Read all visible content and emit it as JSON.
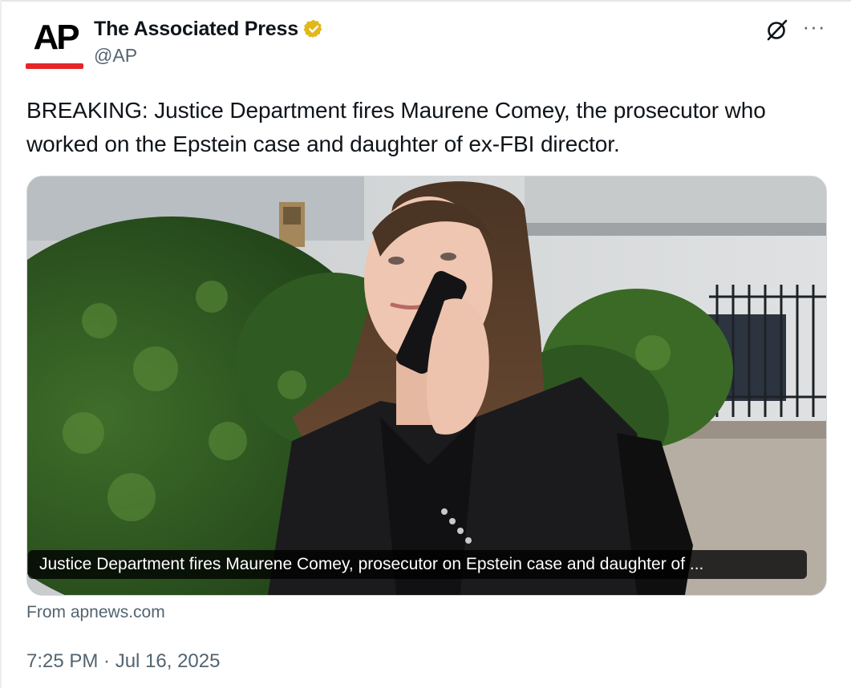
{
  "tweet": {
    "author": {
      "display_name": "The Associated Press",
      "handle": "@AP",
      "logo_text": "AP",
      "logo_accent_color": "#e4262b",
      "verified_badge_color": "#e2b719",
      "verified_icon": "verified-badge-icon"
    },
    "actions": {
      "grok_icon": "grok-icon",
      "more_label": "···"
    },
    "text": "BREAKING: Justice Department fires Maurene Comey, the prosecutor who worked on the Epstein case and daughter of ex-FBI director.",
    "card": {
      "image_alt": "photo of a woman in a dark blazer talking on a phone outside a building",
      "caption": "Justice Department fires Maurene Comey, prosecutor on Epstein case and daughter of ...",
      "source": "From apnews.com"
    },
    "timestamp": "7:25 PM · Jul 16, 2025"
  }
}
